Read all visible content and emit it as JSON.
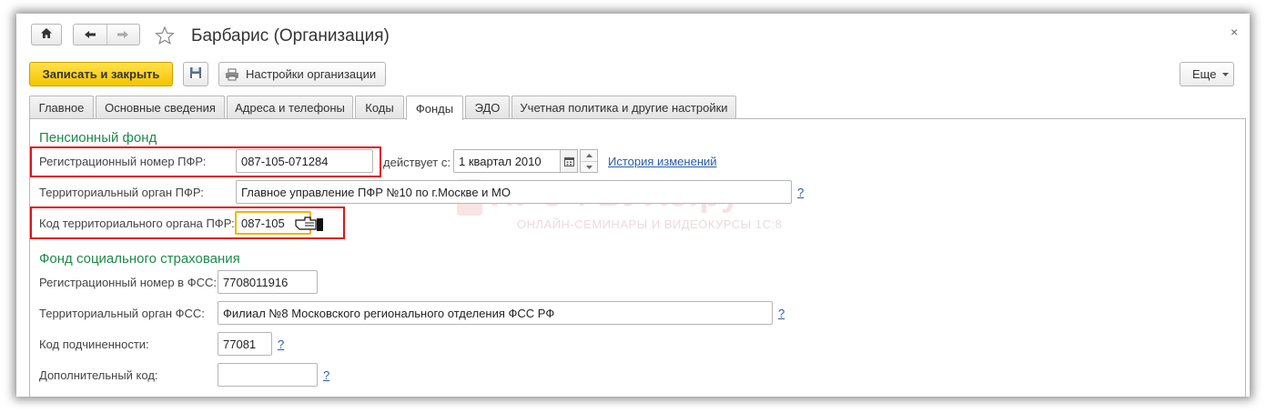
{
  "window": {
    "title": "Барбарис (Организация)",
    "close_glyph": "×"
  },
  "toolbar": {
    "save_close_label": "Записать и закрыть",
    "settings_label": "Настройки организации",
    "more_label": "Еще"
  },
  "tabs": [
    {
      "label": "Главное"
    },
    {
      "label": "Основные сведения"
    },
    {
      "label": "Адреса и телефоны"
    },
    {
      "label": "Коды"
    },
    {
      "label": "Фонды"
    },
    {
      "label": "ЭДО"
    },
    {
      "label": "Учетная политика и другие настройки"
    }
  ],
  "active_tab": "Фонды",
  "pfr": {
    "section_title": "Пенсионный фонд",
    "reg_number_label": "Регистрационный номер ПФР:",
    "reg_number_value": "087-105-071284",
    "valid_from_label": "действует с:",
    "valid_from_value": "1 квартал 2010",
    "history_link": "История изменений",
    "territorial_label": "Территориальный орган ПФР:",
    "territorial_value": "Главное управление ПФР №10 по г.Москве и МО",
    "territorial_code_label": "Код территориального органа ПФР:",
    "territorial_code_value": "087-105"
  },
  "fss": {
    "section_title": "Фонд социального страхования",
    "reg_number_label": "Регистрационный номер в ФСС:",
    "reg_number_value": "7708011916",
    "territorial_label": "Территориальный орган ФСС:",
    "territorial_value": "Филиал №8 Московского регионального отделения ФСС РФ",
    "subordination_label": "Код подчиненности:",
    "subordination_value": "77081",
    "additional_code_label": "Дополнительный код:",
    "additional_code_value": ""
  },
  "help_glyph": "?",
  "watermark": {
    "brand": "ПРОФБУХ8.ру",
    "tagline": "ОНЛАЙН-СЕМИНАРЫ И ВИДЕОКУРСЫ 1С:8"
  },
  "colors": {
    "section_title": "#1e8a4a",
    "primary_button": "#f5c400",
    "highlight_box": "#e0121b",
    "link": "#2a5ca8"
  }
}
